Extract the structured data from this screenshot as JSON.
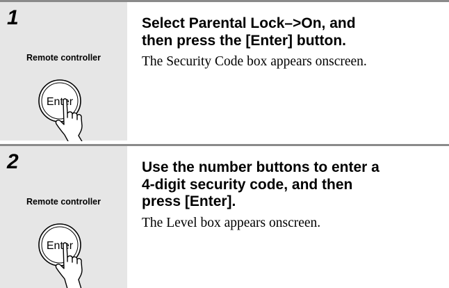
{
  "steps": [
    {
      "number": "1",
      "side_label": "Remote controller",
      "button_label": "Enter",
      "heading_lines": [
        "Select Parental Lock–>On, and",
        "then press the [Enter] button."
      ],
      "body": "The Security Code box appears onscreen."
    },
    {
      "number": "2",
      "side_label": "Remote controller",
      "button_label": "Enter",
      "heading_lines": [
        "Use the number buttons to enter a",
        "4-digit security code, and then",
        "press [Enter]."
      ],
      "body": "The Level box appears onscreen."
    }
  ],
  "colors": {
    "sidebar": "#e6e6e6",
    "rule": "#8a8a8a"
  },
  "icons": [
    "remote-enter-button-icon",
    "pressing-hand-icon"
  ]
}
